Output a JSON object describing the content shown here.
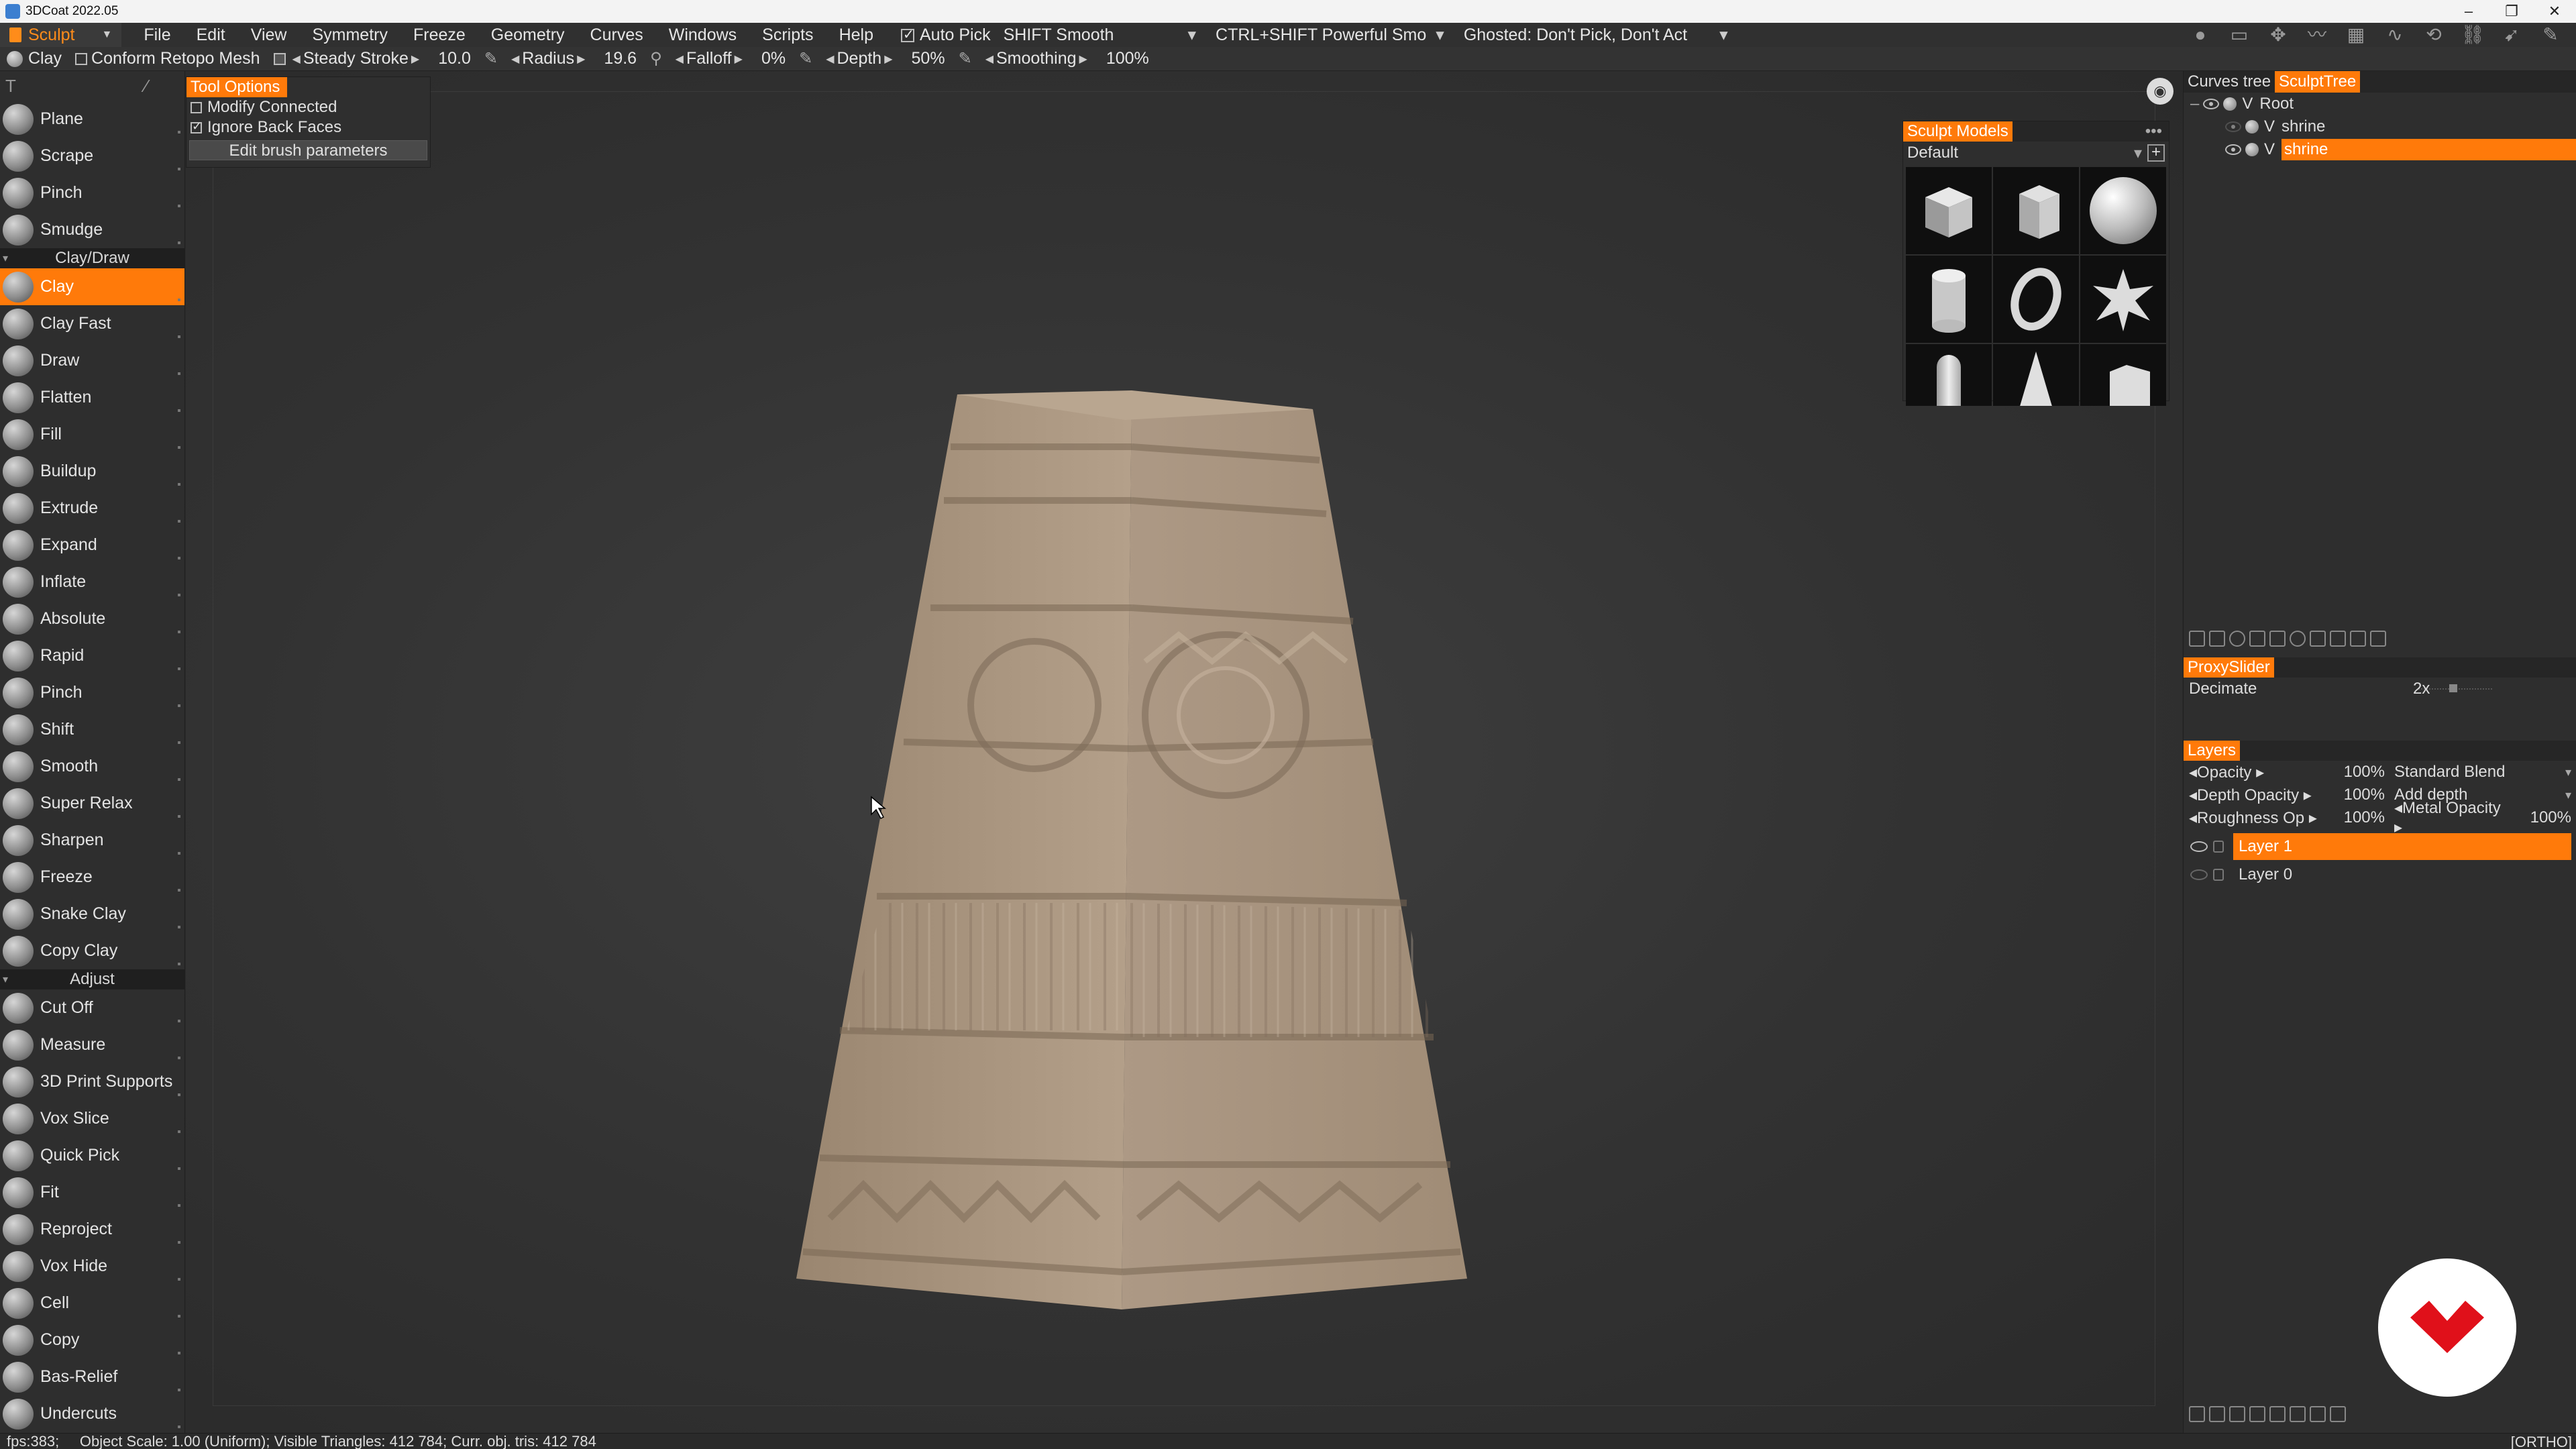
{
  "window": {
    "title": "3DCoat 2022.05",
    "controls": [
      "–",
      "❐",
      "✕"
    ]
  },
  "menubar": {
    "room": "Sculpt",
    "items": [
      "File",
      "Edit",
      "View",
      "Symmetry",
      "Freeze",
      "Geometry",
      "Curves",
      "Windows",
      "Scripts",
      "Help"
    ],
    "auto_pick": "Auto Pick",
    "shift_smooth": "SHIFT Smooth",
    "ctrl_shift": "CTRL+SHIFT Powerful Smo",
    "ghosted": "Ghosted: Don't Pick, Don't Act"
  },
  "optbar": {
    "tool": "Clay",
    "conform": "Conform Retopo Mesh",
    "steady_stroke": "Steady Stroke",
    "steady_value": "10.0",
    "radius_label": "Radius",
    "radius_value": "19.6",
    "falloff_label": "Falloff",
    "falloff_value": "0%",
    "depth_label": "Depth",
    "depth_value": "50%",
    "smoothing_label": "Smoothing",
    "smoothing_value": "100%"
  },
  "tool_options": {
    "title": "Tool Options",
    "modify_connected": "Modify Connected",
    "ignore_back_faces": "Ignore Back Faces",
    "edit_brush": "Edit brush parameters"
  },
  "tools": {
    "group1": [
      "Plane",
      "Scrape",
      "Pinch",
      "Smudge"
    ],
    "section_clay": "Clay/Draw",
    "group2": [
      "Clay",
      "Clay Fast",
      "Draw",
      "Flatten",
      "Fill",
      "Buildup",
      "Extrude",
      "Expand",
      "Inflate",
      "Absolute",
      "Rapid",
      "Pinch",
      "Shift",
      "Smooth",
      "Super Relax",
      "Sharpen",
      "Freeze",
      "Snake Clay",
      "Copy Clay"
    ],
    "section_adjust": "Adjust",
    "group3": [
      "Cut Off",
      "Measure",
      "3D Print Supports",
      "Vox Slice",
      "Quick Pick",
      "Fit",
      "Reproject",
      "Vox Hide",
      "Cell",
      "Copy",
      "Bas-Relief",
      "Undercuts"
    ]
  },
  "sculpt_models": {
    "title": "Sculpt Models",
    "preset": "Default"
  },
  "right": {
    "tab_curves": "Curves tree",
    "tab_sculpt": "SculptTree",
    "root": "Root",
    "obj1": "shrine",
    "obj2": "shrine",
    "v": "V",
    "proxy_title": "ProxySlider",
    "decimate_label": "Decimate",
    "decimate_value": "2x",
    "layers_title": "Layers",
    "opacity_label": "Opacity",
    "opacity_value": "100%",
    "blend": "Standard Blend",
    "depth_opacity_label": "Depth Opacity",
    "depth_opacity_value": "100%",
    "depth_mode": "Add depth",
    "roughness_label": "Roughness Op",
    "roughness_value": "100%",
    "metal_label": "Metal Opacity",
    "metal_value": "100%",
    "layer1": "Layer 1",
    "layer0": "Layer 0"
  },
  "status": {
    "left": "fps:383;     Object Scale: 1.00 (Uniform); Visible Triangles: 412 784; Curr. obj. tris: 412 784",
    "right": "[ORTHO]"
  },
  "colors": {
    "accent": "#ff7a0a",
    "panel": "#2e2e2e",
    "clay": "#b5a089",
    "logo_red": "#e0101a"
  }
}
